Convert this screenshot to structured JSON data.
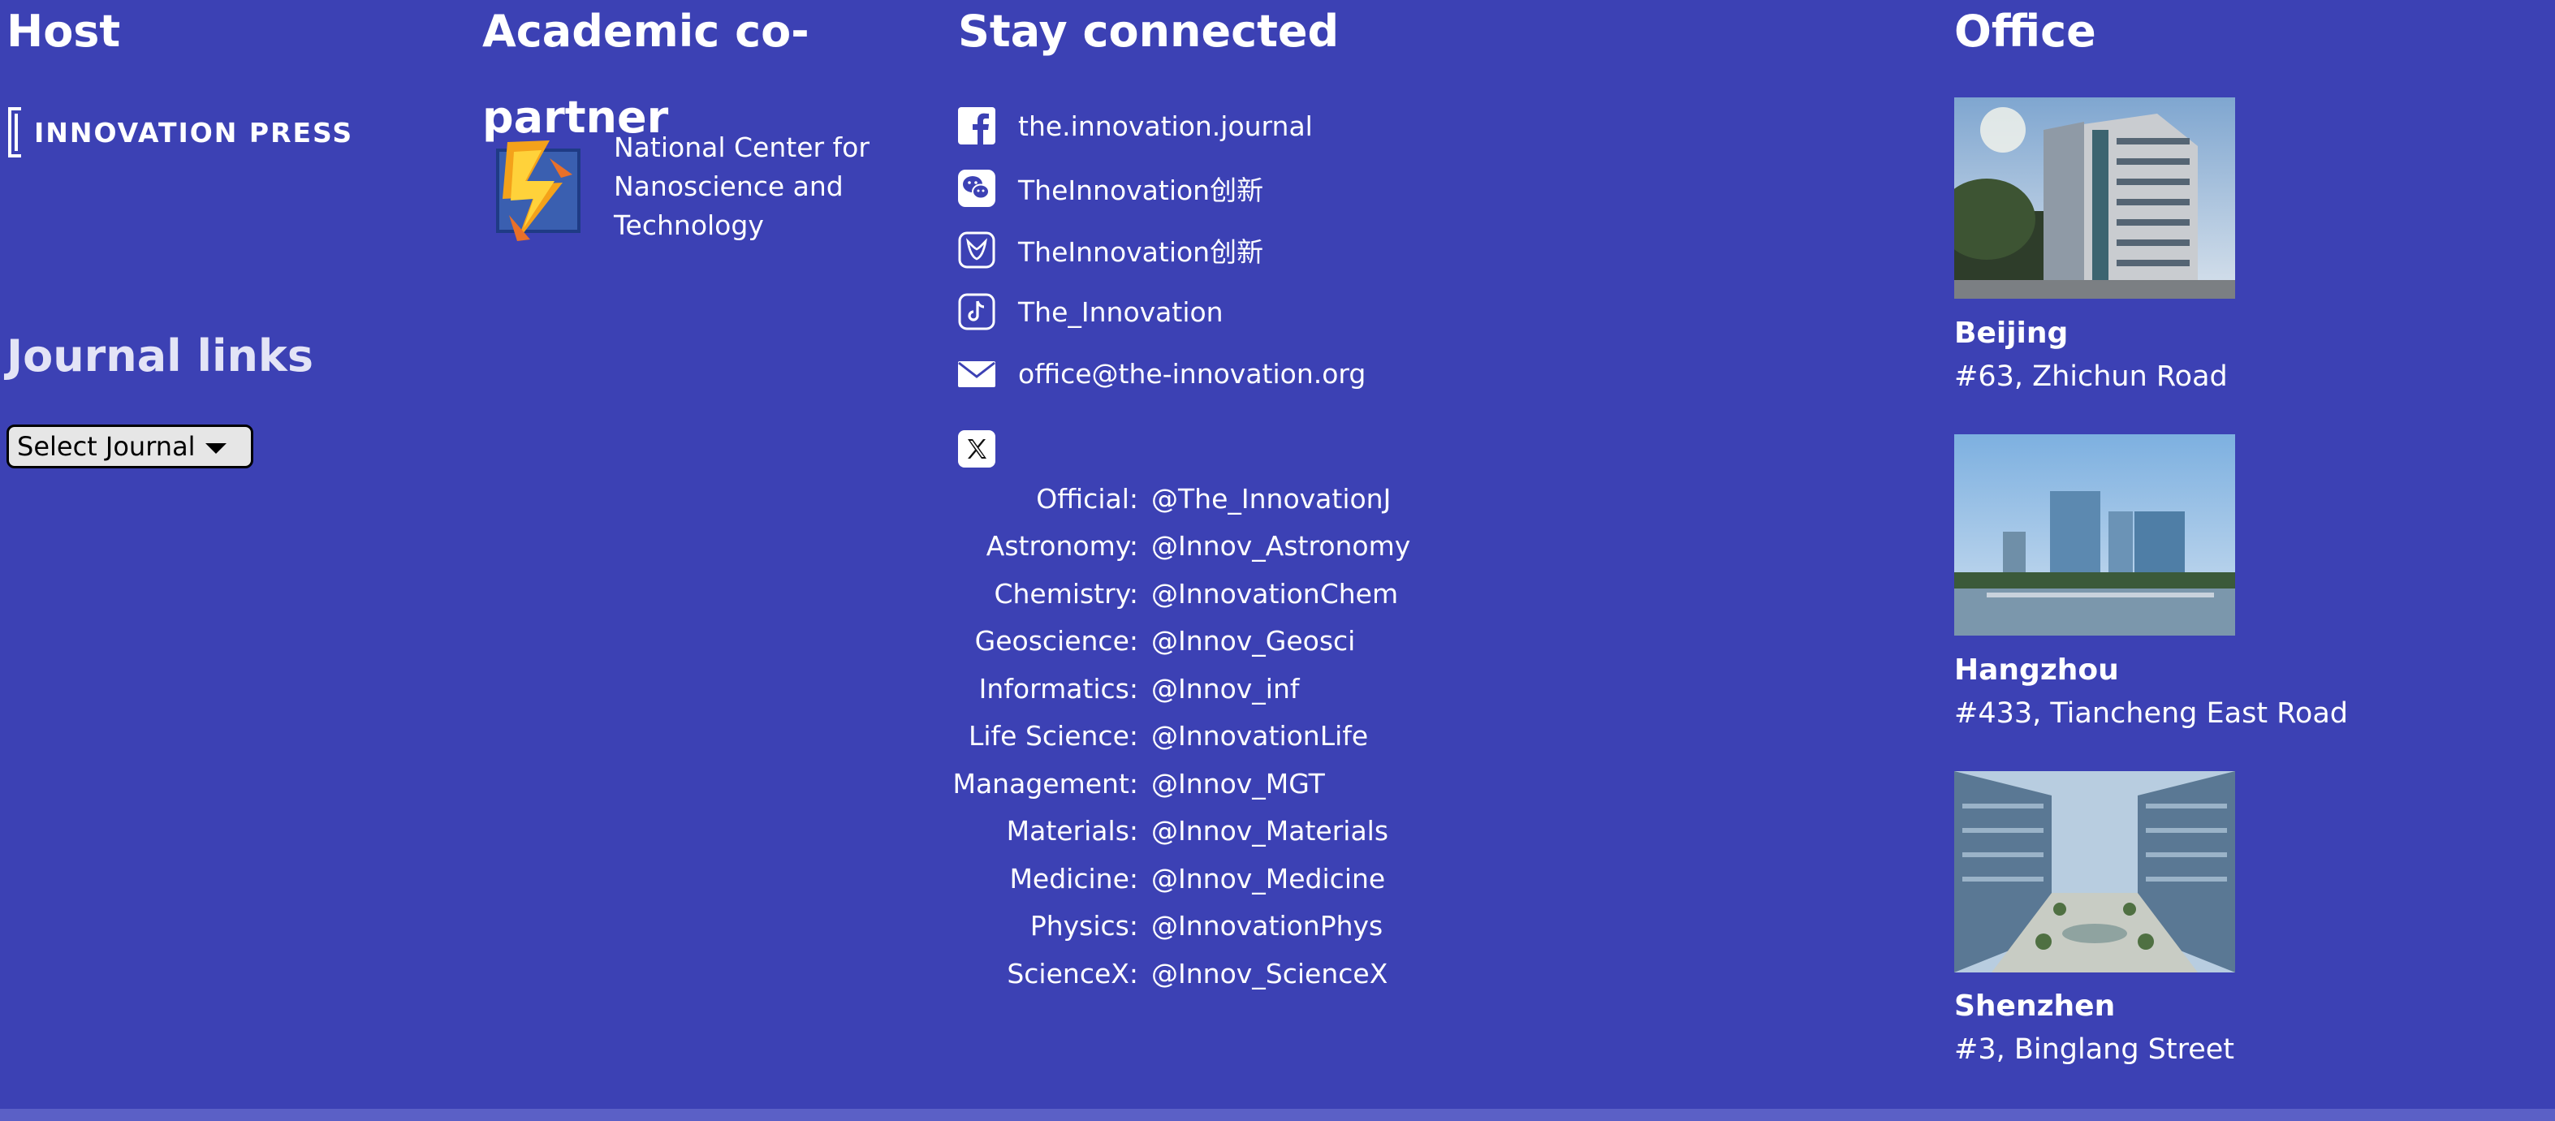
{
  "host": {
    "title": "Host",
    "logo_text": "INNOVATION PRESS"
  },
  "academic": {
    "title": "Academic co-partner",
    "partner_name": "National Center for Nanoscience and Technology"
  },
  "journal_links": {
    "title": "Journal links",
    "select_value": "Select Journal"
  },
  "stay_connected": {
    "title": "Stay connected",
    "items": [
      {
        "icon": "facebook-icon",
        "text": "the.innovation.journal"
      },
      {
        "icon": "wechat-icon",
        "text": "TheInnovation创新"
      },
      {
        "icon": "weibo-icon",
        "text": "TheInnovation创新"
      },
      {
        "icon": "tiktok-icon",
        "text": "The_Innovation"
      },
      {
        "icon": "mail-icon",
        "text": "office@the-innovation.org"
      }
    ],
    "x_icon": "x-icon",
    "x_accounts": [
      {
        "label": "Official:",
        "handle": "@The_InnovationJ"
      },
      {
        "label": "Astronomy:",
        "handle": "@Innov_Astronomy"
      },
      {
        "label": "Chemistry:",
        "handle": "@InnovationChem"
      },
      {
        "label": "Geoscience:",
        "handle": "@Innov_Geosci"
      },
      {
        "label": "Informatics:",
        "handle": "@Innov_inf"
      },
      {
        "label": "Life Science:",
        "handle": "@InnovationLife"
      },
      {
        "label": "Management:",
        "handle": "@Innov_MGT"
      },
      {
        "label": "Materials:",
        "handle": "@Innov_Materials"
      },
      {
        "label": "Medicine:",
        "handle": "@Innov_Medicine"
      },
      {
        "label": "Physics:",
        "handle": "@InnovationPhys"
      },
      {
        "label": "ScienceX:",
        "handle": "@Innov_ScienceX"
      }
    ]
  },
  "office": {
    "title": "Office",
    "locations": [
      {
        "city": "Beijing",
        "address": "#63, Zhichun Road"
      },
      {
        "city": "Hangzhou",
        "address": "#433, Tiancheng East Road"
      },
      {
        "city": "Shenzhen",
        "address": "#3, Binglang Street"
      }
    ]
  },
  "colors": {
    "background": "#3c41b4",
    "bottom_bar": "#5b60c6",
    "text": "#ffffff"
  }
}
